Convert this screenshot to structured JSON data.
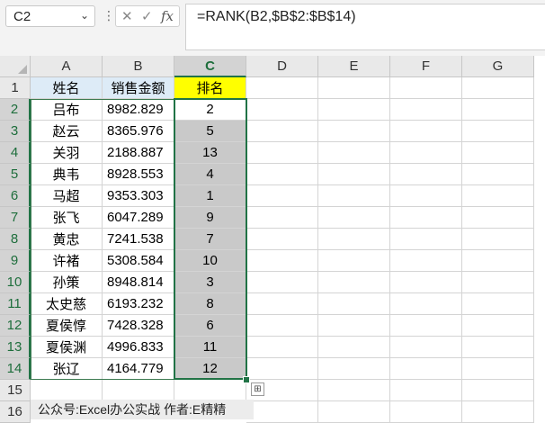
{
  "name_box": {
    "value": "C2"
  },
  "formula_bar": {
    "cancel_symbol": "✕",
    "enter_symbol": "✓",
    "fx_symbol": "fx",
    "formula": "=RANK(B2,$B$2:$B$14)"
  },
  "columns": [
    "A",
    "B",
    "C",
    "D",
    "E",
    "F",
    "G"
  ],
  "rows": [
    "1",
    "2",
    "3",
    "4",
    "5",
    "6",
    "7",
    "8",
    "9",
    "10",
    "11",
    "12",
    "13",
    "14",
    "15",
    "16"
  ],
  "headers": {
    "name": "姓名",
    "amount": "销售金额",
    "rank": "排名"
  },
  "data": [
    {
      "name": "吕布",
      "amount": "8982.829",
      "rank": "2"
    },
    {
      "name": "赵云",
      "amount": "8365.976",
      "rank": "5"
    },
    {
      "name": "关羽",
      "amount": "2188.887",
      "rank": "13"
    },
    {
      "name": "典韦",
      "amount": "8928.553",
      "rank": "4"
    },
    {
      "name": "马超",
      "amount": "9353.303",
      "rank": "1"
    },
    {
      "name": "张飞",
      "amount": "6047.289",
      "rank": "9"
    },
    {
      "name": "黄忠",
      "amount": "7241.538",
      "rank": "7"
    },
    {
      "name": "许褚",
      "amount": "5308.584",
      "rank": "10"
    },
    {
      "name": "孙策",
      "amount": "8948.814",
      "rank": "3"
    },
    {
      "name": "太史慈",
      "amount": "6193.232",
      "rank": "8"
    },
    {
      "name": "夏侯惇",
      "amount": "7428.328",
      "rank": "6"
    },
    {
      "name": "夏侯渊",
      "amount": "4996.833",
      "rank": "11"
    },
    {
      "name": "张辽",
      "amount": "4164.779",
      "rank": "12"
    }
  ],
  "footer_note": "公众号:Excel办公实战  作者:E精精",
  "colors": {
    "header_blue": "#ddebf7",
    "rank_header_yellow": "#ffff00",
    "selected_gray": "#c9c9c9",
    "excel_green": "#217346"
  }
}
